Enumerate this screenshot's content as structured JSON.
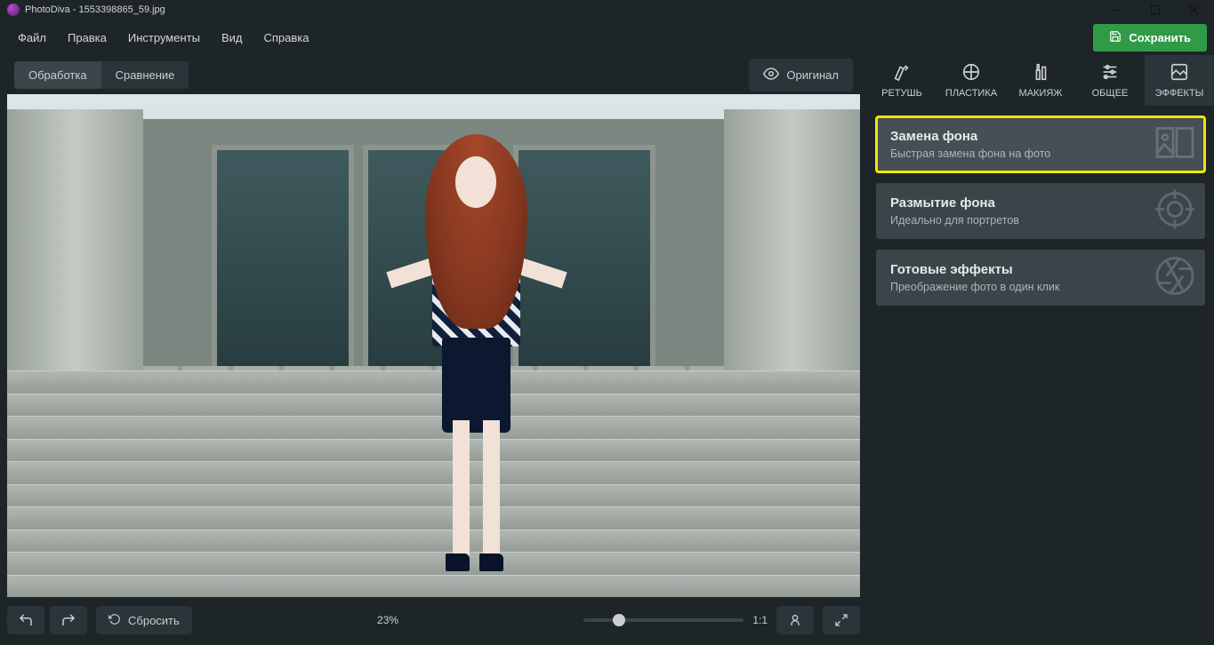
{
  "window": {
    "title": "PhotoDiva - 1553398865_59.jpg"
  },
  "menu": {
    "file": "Файл",
    "edit": "Правка",
    "tools": "Инструменты",
    "view": "Вид",
    "help": "Справка"
  },
  "save_button": "Сохранить",
  "view_tabs": {
    "edit": "Обработка",
    "compare": "Сравнение"
  },
  "original_button": "Оригинал",
  "footer": {
    "reset": "Сбросить",
    "zoom": "23%",
    "scale": "1:1"
  },
  "tool_tabs": {
    "retouch": "РЕТУШЬ",
    "plastic": "ПЛАСТИКА",
    "makeup": "МАКИЯЖ",
    "general": "ОБЩЕЕ",
    "effects": "ЭФФЕКТЫ"
  },
  "effects": {
    "bg_replace": {
      "title": "Замена фона",
      "sub": "Быстрая замена фона на фото"
    },
    "bg_blur": {
      "title": "Размытие фона",
      "sub": "Идеально для портретов"
    },
    "presets": {
      "title": "Готовые эффекты",
      "sub": "Преображение фото в один клик"
    }
  }
}
